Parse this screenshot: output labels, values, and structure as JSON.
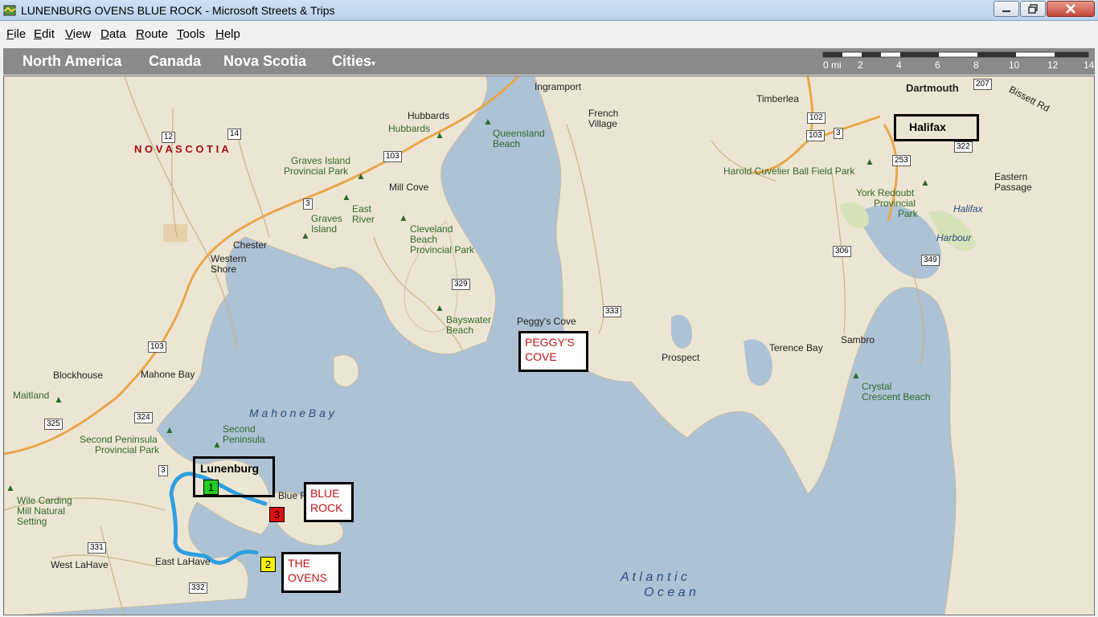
{
  "window": {
    "title": "LUNENBURG OVENS BLUE ROCK - Microsoft Streets & Trips"
  },
  "menu": [
    "File",
    "Edit",
    "View",
    "Data",
    "Route",
    "Tools",
    "Help"
  ],
  "nav": {
    "crumbs": [
      "North America",
      "Canada",
      "Nova Scotia"
    ],
    "dropdown": "Cities"
  },
  "scale": {
    "ticks": [
      "0 mi",
      "2",
      "4",
      "6",
      "8",
      "10",
      "12",
      "14"
    ]
  },
  "labels": {
    "nova_scotia": "N O V A   S C O T I A",
    "ingramport": "Ingramport",
    "hubbards": "Hubbards",
    "hubbards2": "Hubbards",
    "queensland": "Queensland",
    "queensland2": "Beach",
    "french": "French",
    "french2": "Village",
    "timberlea": "Timberlea",
    "dartmouth": "Dartmouth",
    "bissett": "Bissett Rd",
    "graves_isl_pp": "Graves Island",
    "graves_isl_pp2": "Provincial Park",
    "mill_cove": "Mill Cove",
    "east_river": "East",
    "east_river2": "River",
    "graves_isl": "Graves",
    "graves_isl2": "Island",
    "cleveland": "Cleveland",
    "cleveland2": "Beach",
    "cleveland3": "Provincial Park",
    "chester": "Chester",
    "western": "Western",
    "western2": "Shore",
    "harold": "Harold Cuvelier Ball Field Park",
    "york": "York Redoubt",
    "york2": "Provincial",
    "york3": "Park",
    "eastern": "Eastern",
    "eastern2": "Passage",
    "halifax_water": "Halifax",
    "harbour": "Harbour",
    "bayswater": "Bayswater",
    "bayswater2": "Beach",
    "peggys": "Peggy's Cove",
    "prospect": "Prospect",
    "terence": "Terence Bay",
    "sambro": "Sambro",
    "crystal": "Crystal",
    "crystal2": "Crescent Beach",
    "blockhouse": "Blockhouse",
    "mahone": "Mahone Bay",
    "maitland": "Maitland",
    "mahone_bay_water": "M a h o n e   B a y",
    "second_pen": "Second",
    "second_pen2": "Peninsula",
    "second_pp": "Second Peninsula",
    "second_pp2": "Provincial Park",
    "blue_rock_small": "Blue Ro",
    "wile": "Wile Carding",
    "wile2": "Mill Natural",
    "wile3": "Setting",
    "west_lahave": "West LaHave",
    "east_lahave": "East LaHave",
    "atlantic": "A t l a n t i c",
    "ocean": "O c e a n"
  },
  "shields": {
    "r12": "12",
    "r14": "14",
    "r103a": "103",
    "r103b": "103",
    "r103c": "103",
    "r3a": "3",
    "r3b": "3",
    "r3c": "3",
    "r329": "329",
    "r333": "333",
    "r102": "102",
    "r207": "207",
    "r322": "322",
    "r253": "253",
    "r306": "306",
    "r349": "349",
    "r325": "325",
    "r324": "324",
    "r331": "331",
    "r332": "332"
  },
  "callouts": {
    "lunenburg": "Lunenburg",
    "halifax": "Halifax",
    "peggys_cove": [
      "PEGGY'S",
      "COVE"
    ],
    "blue_rock": [
      "BLUE",
      "ROCK"
    ],
    "the_ovens": [
      "THE",
      "OVENS"
    ]
  },
  "markers": [
    {
      "num": "1",
      "color": "#22cc22"
    },
    {
      "num": "2",
      "color": "#f5f500"
    },
    {
      "num": "3",
      "color": "#dd1111"
    }
  ],
  "colors": {
    "water": "#adc2d4",
    "land": "#ede5d3",
    "route": "#2f9fe0",
    "road": "#e9a64a",
    "callout_text": "#c0151b"
  }
}
